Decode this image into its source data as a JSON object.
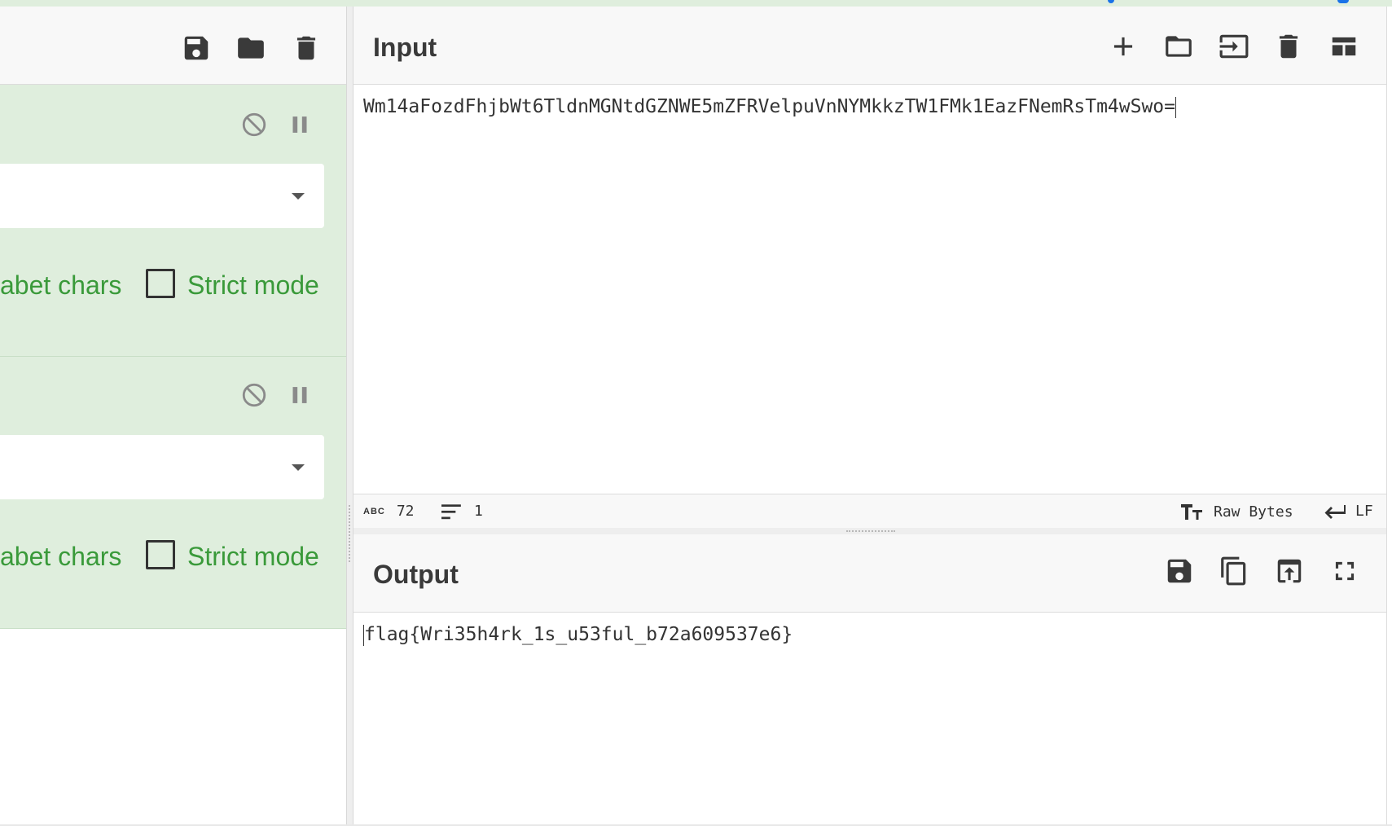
{
  "colors": {
    "operation_bg": "#dfeedd",
    "operation_text": "#3a9a3a",
    "header_bg": "#f8f8f8",
    "accent": "#1a73e8"
  },
  "recipe": {
    "toolbar_icons": [
      "save-icon",
      "folder-icon",
      "trash-icon"
    ],
    "operations": [
      {
        "disable_icon": "disable-icon",
        "pause_icon": "pause-icon",
        "dropdown_value": "",
        "alphabet_label": "abet chars",
        "strict_label": "Strict mode",
        "strict_checked": false
      },
      {
        "disable_icon": "disable-icon",
        "pause_icon": "pause-icon",
        "dropdown_value": "",
        "alphabet_label": "abet chars",
        "strict_label": "Strict mode",
        "strict_checked": false
      }
    ]
  },
  "input": {
    "title": "Input",
    "toolbar_icons": [
      "add-icon",
      "folder-icon",
      "import-icon",
      "trash-icon",
      "layout-icon"
    ],
    "text": "Wm14aFozdFhjbWt6TldnMGNtdGZNWE5mZFRVelpuVnNYMkkzTW1FMk1EazFNemRsTm4wSwo=",
    "status": {
      "char_label": "ABC",
      "char_count": "72",
      "line_count": "1",
      "encoding": "Raw Bytes",
      "eol": "LF"
    }
  },
  "output": {
    "title": "Output",
    "toolbar_icons": [
      "save-icon",
      "copy-icon",
      "replace-input-icon",
      "maximize-icon"
    ],
    "text": "flag{Wri35h4rk_1s_u53ful_b72a609537e6}"
  }
}
